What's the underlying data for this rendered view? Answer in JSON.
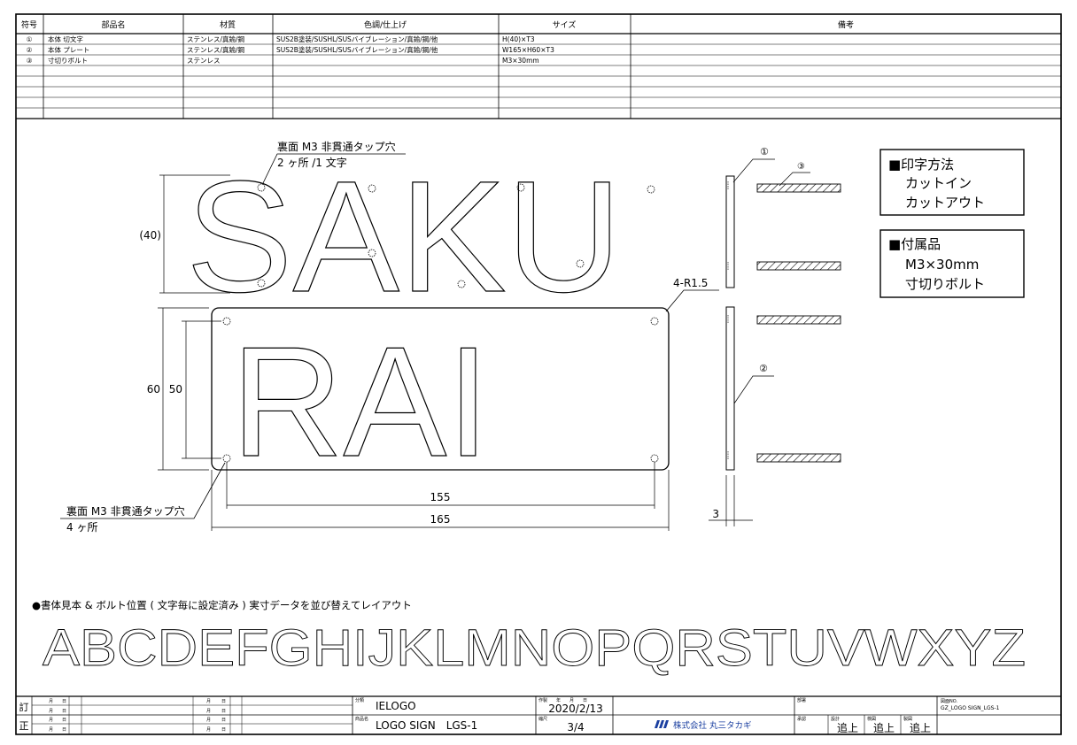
{
  "parts_table": {
    "headers": [
      "符号",
      "部品名",
      "材質",
      "色調/仕上げ",
      "サイズ",
      "備考"
    ],
    "rows": [
      [
        "①",
        "本体 切文字",
        "ステンレス/真鍮/鋼",
        "SUS2B塗装/SUSHL/SUSバイブレーション/真鍮/鋼/他",
        "H(40)×T3",
        ""
      ],
      [
        "②",
        "本体 プレート",
        "ステンレス/真鍮/鋼",
        "SUS2B塗装/SUSHL/SUSバイブレーション/真鍮/鋼/他",
        "W165×H60×T3",
        ""
      ],
      [
        "③",
        "寸切りボルト",
        "ステンレス",
        "",
        "M3×30mm",
        ""
      ]
    ]
  },
  "drawing": {
    "text_line1": "SAKU",
    "text_line2": "RAI",
    "tap_note_top_1": "裏面 M3 非貫通タップ穴",
    "tap_note_top_2": "2 ヶ所 /1 文字",
    "tap_note_bottom_1": "裏面 M3 非貫通タップ穴",
    "tap_note_bottom_2": "4 ヶ所",
    "dim_letter_height": "(40)",
    "dim_plate_height": "60",
    "dim_hole_vertical": "50",
    "dim_hole_horizontal": "155",
    "dim_plate_width": "165",
    "dim_corner_radius": "4-R1.5",
    "dim_thickness": "3",
    "callout_1": "①",
    "callout_2": "②",
    "callout_3": "③"
  },
  "print_method": {
    "title": "■印字方法",
    "line1": "カットイン",
    "line2": "カットアウト"
  },
  "accessories": {
    "title": "■付属品",
    "line1": "M3×30mm",
    "line2": "寸切りボルト"
  },
  "font_sample": {
    "caption": "●書体見本 & ボルト位置 ( 文字毎に設定済み ) 実寸データを並び替えてレイアウト",
    "alphabet": "ABCDEFGHIJKLMNOPQRSTUVWXYZ"
  },
  "title_block": {
    "row_label_1": "訂",
    "row_label_2": "正",
    "month": "月",
    "day": "日",
    "category_label": "分類",
    "category": "IELOGO",
    "product_label": "商品名",
    "product": "LOGO SIGN　LGS-1",
    "date_label": "作製　　年　　月　　日",
    "date": "2020/2/13",
    "scale_label": "縮尺",
    "scale": "3/4",
    "company": "株式会社 丸三タカギ",
    "dept_label": "部署",
    "approve_label": "承認",
    "design_label": "設計",
    "check_label": "検図",
    "draw_label": "製図",
    "approve_1": "追上",
    "approve_2": "追上",
    "approve_3": "追上",
    "drawing_no_label": "図面NO.",
    "drawing_no": "GZ_LOGO SIGN_LGS-1"
  }
}
